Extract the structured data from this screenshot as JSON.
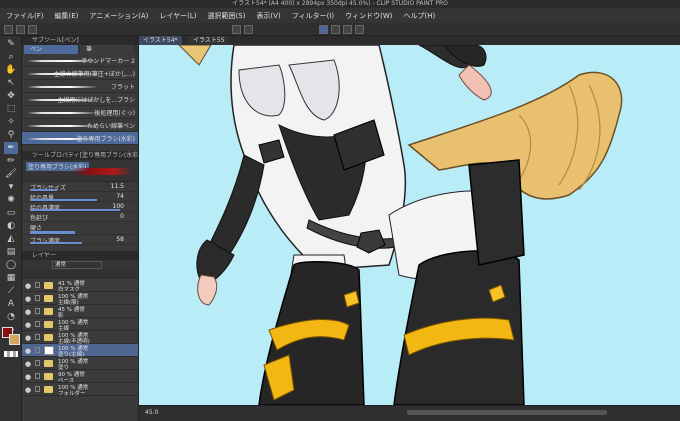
{
  "window": {
    "title": "イラスト54* (A4 400) x 2894px 350dpi 45.0%) - CLIP STUDIO PAINT PRO"
  },
  "menu": [
    {
      "id": "file",
      "label": "ファイル(F)"
    },
    {
      "id": "edit",
      "label": "編集(E)"
    },
    {
      "id": "anim",
      "label": "アニメーション(A)"
    },
    {
      "id": "layer",
      "label": "レイヤー(L)"
    },
    {
      "id": "select",
      "label": "選択範囲(S)"
    },
    {
      "id": "view",
      "label": "表示(V)"
    },
    {
      "id": "filter",
      "label": "フィルター(I)"
    },
    {
      "id": "window",
      "label": "ウィンドウ(W)"
    },
    {
      "id": "help",
      "label": "ヘルプ(H)"
    }
  ],
  "subtool_panel": {
    "header": "サブツール[ペン]",
    "tabs": [
      "ペン",
      "筆"
    ],
    "brushes": [
      {
        "label": "ラウンドマーカー 2"
      },
      {
        "label": "主線の線筆用(筆圧+ぼかし...)"
      },
      {
        "label": "フラット"
      },
      {
        "label": "主線用にはぼかしを...ブラシ"
      },
      {
        "label": "後処理用(ぐっ)"
      },
      {
        "label": "ためらい線筆ペン"
      },
      {
        "label": "塗り専用ブラシ(水彩)"
      }
    ]
  },
  "tool_property": {
    "header": "ツールプロパティ[塗り専用ブラシ(水彩)]",
    "name": "塗り専用ブラシ(水彩)",
    "rows": [
      {
        "label": "ブラシサイズ",
        "value": "11.5",
        "fill": 0.3
      },
      {
        "label": "絵の具量",
        "value": "74",
        "fill": 0.74
      },
      {
        "label": "絵の具濃度",
        "value": "100",
        "fill": 1.0
      },
      {
        "label": "色延び",
        "value": "0",
        "fill": 0
      },
      {
        "label": "硬さ",
        "value": "",
        "fill": 0.5
      },
      {
        "label": "ブラシ濃度",
        "value": "58",
        "fill": 0.58
      }
    ]
  },
  "layer_panel": {
    "header": "レイヤー",
    "blend": "通常",
    "layers": [
      {
        "pct": "41 % 通常",
        "name": "白マスク",
        "type": "folder",
        "selected": false
      },
      {
        "pct": "100 % 通常",
        "name": "主線(服)",
        "type": "folder",
        "selected": false
      },
      {
        "pct": "45 % 通常",
        "name": "影",
        "type": "folder",
        "selected": false
      },
      {
        "pct": "100 % 通常",
        "name": "主線",
        "type": "folder",
        "selected": false
      },
      {
        "pct": "100 % 通常",
        "name": "主線(不透明)",
        "type": "folder",
        "selected": false
      },
      {
        "pct": "100 % 通常",
        "name": "塗り(主線)",
        "type": "layer",
        "selected": true
      },
      {
        "pct": "100 % 通常",
        "name": "塗り",
        "type": "folder",
        "selected": false
      },
      {
        "pct": "90 % 通常",
        "name": "ベース",
        "type": "folder",
        "selected": false
      },
      {
        "pct": "100 % 通常",
        "name": "フォルダー",
        "type": "folder",
        "selected": false
      }
    ]
  },
  "canvas_tabs": [
    {
      "label": "イラスト54*"
    },
    {
      "label": "イラスト55"
    }
  ],
  "status": {
    "zoom": "45.0"
  },
  "colors": {
    "main": "#8a0f0f",
    "sub": "#d3a560",
    "canvas_bg": "#b8ecf7"
  }
}
